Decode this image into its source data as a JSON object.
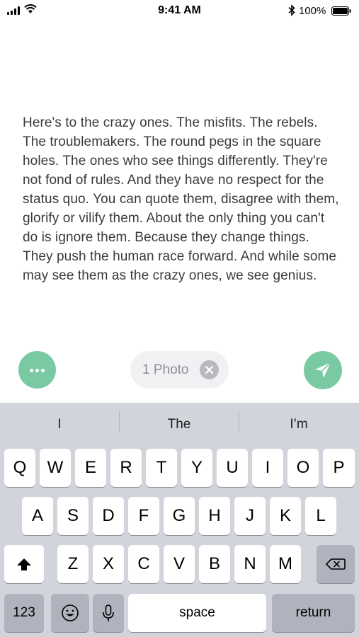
{
  "status_bar": {
    "time": "9:41 AM",
    "battery_percent": "100%"
  },
  "message": {
    "text": "Here's to the crazy ones. The misfits. The rebels. The troublemakers. The round pegs in the square holes. The ones who see things differently. They're not fond of rules. And they have no respect for the status quo. You can quote them, disagree with them, glorify or vilify them. About the only thing you can't do is ignore them. Because they change things. They push the human race forward. And while some may see them as the crazy ones, we see genius."
  },
  "actions": {
    "more_icon": "ellipsis-icon",
    "photo_chip_label": "1 Photo",
    "chip_close_icon": "close-icon",
    "send_icon": "paper-plane-icon",
    "accent_color": "#79c9a3"
  },
  "keyboard": {
    "suggestions": [
      "I",
      "The",
      "I’m"
    ],
    "row1": [
      "Q",
      "W",
      "E",
      "R",
      "T",
      "Y",
      "U",
      "I",
      "O",
      "P"
    ],
    "row2": [
      "A",
      "S",
      "D",
      "F",
      "G",
      "H",
      "J",
      "K",
      "L"
    ],
    "row3": [
      "Z",
      "X",
      "C",
      "V",
      "B",
      "N",
      "M"
    ],
    "numbers_key": "123",
    "space_key": "space",
    "return_key": "return",
    "shift_icon": "shift-icon",
    "delete_icon": "backspace-icon",
    "emoji_icon": "emoji-icon",
    "mic_icon": "microphone-icon"
  }
}
